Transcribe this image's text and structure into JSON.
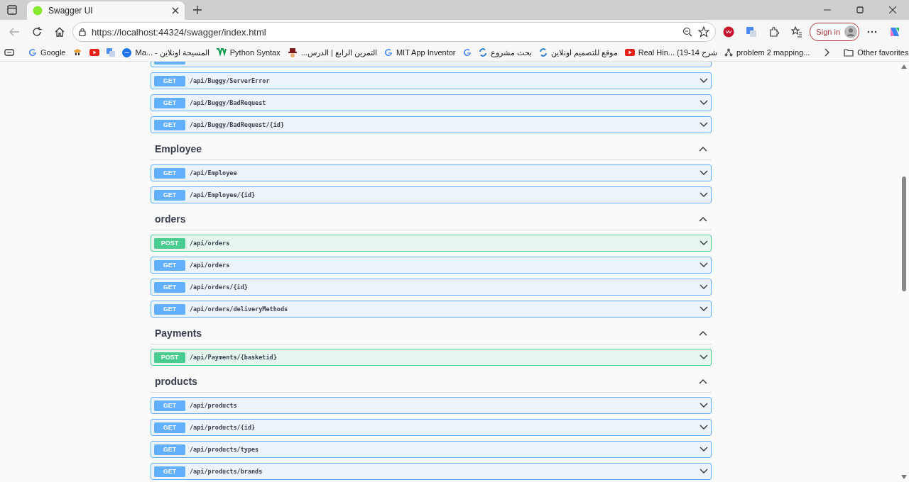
{
  "browser": {
    "tab": {
      "title": "Swagger UI",
      "selected": true
    },
    "url": "https://localhost:44324/swagger/index.html",
    "sign_in": "Sign in",
    "bookmarks": [
      {
        "kind": "labeled",
        "label": "Google"
      },
      {
        "kind": "icon_only"
      },
      {
        "kind": "icon_only"
      },
      {
        "kind": "icon_only"
      },
      {
        "kind": "labeled",
        "label": "Ma... - المسيحة اونلاين"
      },
      {
        "kind": "labeled",
        "label": "Python Syntax"
      },
      {
        "kind": "labeled",
        "label": "التمرين الرابع | الدرس..."
      },
      {
        "kind": "labeled",
        "label": "MIT App Inventor"
      },
      {
        "kind": "icon_only"
      },
      {
        "kind": "labeled",
        "label": "بحث مشروع"
      },
      {
        "kind": "labeled",
        "label": "موقع للتصميم اونلاين"
      },
      {
        "kind": "labeled",
        "label": "Real Hin... (19-14 شرح"
      },
      {
        "kind": "labeled",
        "label": "problem 2 mapping..."
      }
    ],
    "other_favorites": "Other favorites"
  },
  "swagger": {
    "endpoints_top": [
      {
        "method": "GET",
        "path": "/api/Buggy/ServerError"
      },
      {
        "method": "GET",
        "path": "/api/Buggy/BadRequest"
      },
      {
        "method": "GET",
        "path": "/api/Buggy/BadRequest/{id}"
      }
    ],
    "sections": [
      {
        "name": "Employee",
        "expanded": true,
        "endpoints": [
          {
            "method": "GET",
            "path": "/api/Employee"
          },
          {
            "method": "GET",
            "path": "/api/Employee/{id}"
          }
        ]
      },
      {
        "name": "orders",
        "expanded": true,
        "endpoints": [
          {
            "method": "POST",
            "path": "/api/orders"
          },
          {
            "method": "GET",
            "path": "/api/orders"
          },
          {
            "method": "GET",
            "path": "/api/orders/{id}"
          },
          {
            "method": "GET",
            "path": "/api/orders/deliveryMethods"
          }
        ]
      },
      {
        "name": "Payments",
        "expanded": true,
        "endpoints": [
          {
            "method": "POST",
            "path": "/api/Payments/{basketid}"
          }
        ]
      },
      {
        "name": "products",
        "expanded": true,
        "endpoints": [
          {
            "method": "GET",
            "path": "/api/products"
          },
          {
            "method": "GET",
            "path": "/api/products/{id}"
          },
          {
            "method": "GET",
            "path": "/api/products/types"
          },
          {
            "method": "GET",
            "path": "/api/products/brands"
          }
        ]
      }
    ]
  }
}
